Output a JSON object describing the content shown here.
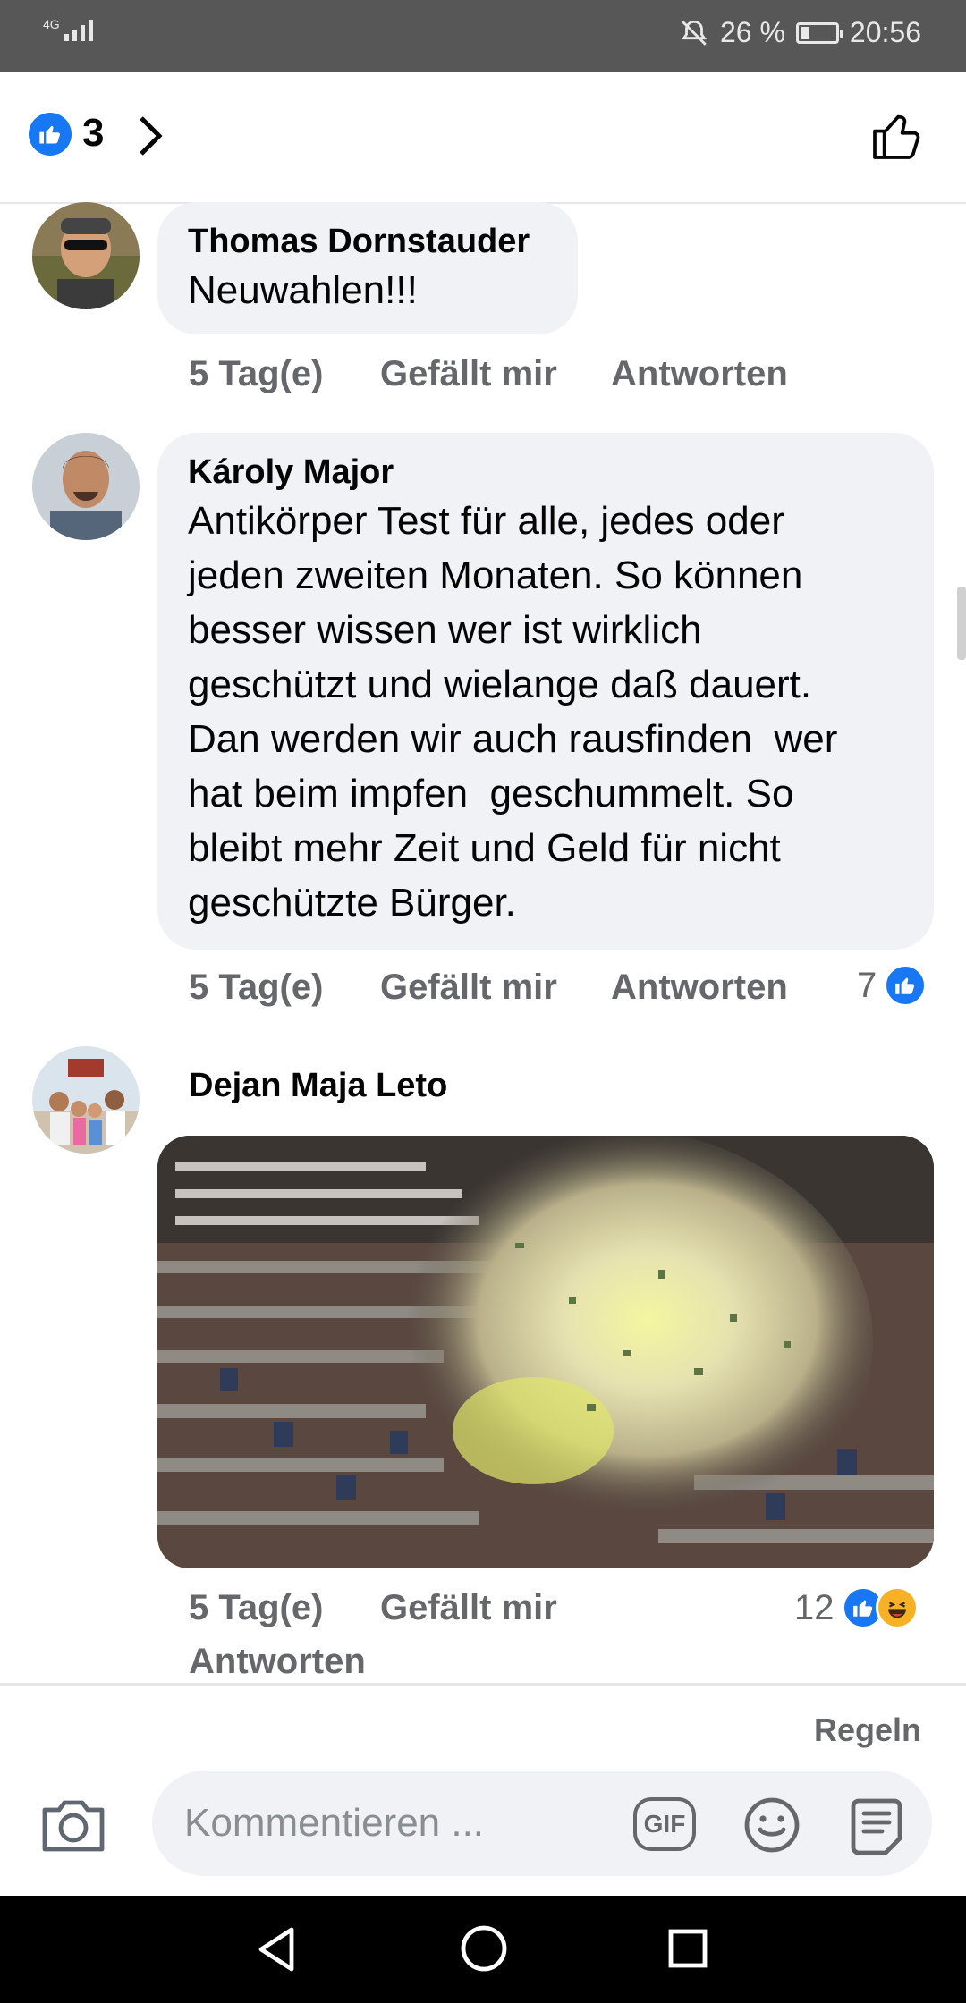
{
  "status_bar": {
    "network": "4G",
    "battery": "26 %",
    "battery_level": 0.26,
    "time": "20:56",
    "icons": [
      "signal-icon",
      "mute-icon",
      "battery-icon"
    ]
  },
  "header": {
    "like_count": "3",
    "icons": [
      "like-reaction-icon",
      "chevron-right-icon",
      "thumbs-up-outline-icon"
    ]
  },
  "comments": [
    {
      "author": "Thomas Dornstauder",
      "text": "Neuwahlen!!!",
      "time": "5 Tag(e)",
      "like_label": "Gefällt mir",
      "reply_label": "Antworten"
    },
    {
      "author": "Károly Major",
      "text_lines": [
        "Antikörper Test für alle, jedes oder",
        "jeden zweiten Monaten. So können",
        "besser wissen wer ist wirklich",
        "geschützt und wielange daß dauert.",
        "Dan werden wir auch rausfinden  wer",
        "hat beim impfen  geschummelt. So",
        "bleibt mehr Zeit und Geld für nicht",
        "geschützte Bürger."
      ],
      "time": "5 Tag(e)",
      "like_label": "Gefällt mir",
      "reply_label": "Antworten",
      "reactions": "7"
    },
    {
      "author": "Dejan Maja Leto",
      "time": "5 Tag(e)",
      "like_label": "Gefällt mir",
      "reply_label": "Antworten",
      "reactions": "12"
    }
  ],
  "footer": {
    "rules": "Regeln",
    "placeholder": "Kommentieren ...",
    "gif": "GIF"
  },
  "colors": {
    "accent": "#1877f2",
    "bubble": "#f0f2f5",
    "secondary_text": "#65676b"
  }
}
